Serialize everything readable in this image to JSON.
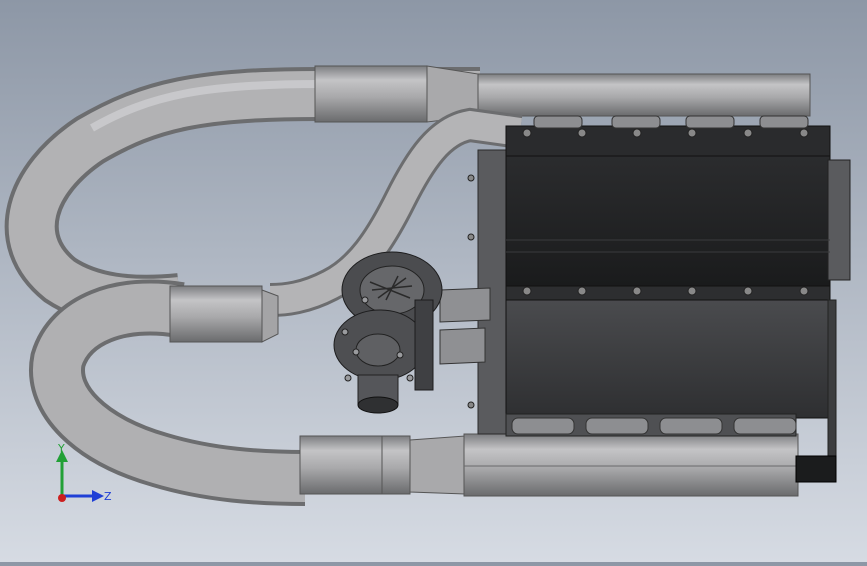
{
  "triad": {
    "y_label": "Y",
    "z_label": "Z",
    "colors": {
      "y_axis": "#22a036",
      "z_axis": "#1f3fd6",
      "x_axis": "#cc1f1f"
    }
  },
  "scene": {
    "colors": {
      "pipe": "#a8a8aa",
      "pipe_shade": "#6f7072",
      "engine_dark": "#1e1f21",
      "engine_mid": "#3a3b3d",
      "engine_light": "#5d5f62",
      "turbo": "#4a4b4e"
    }
  }
}
